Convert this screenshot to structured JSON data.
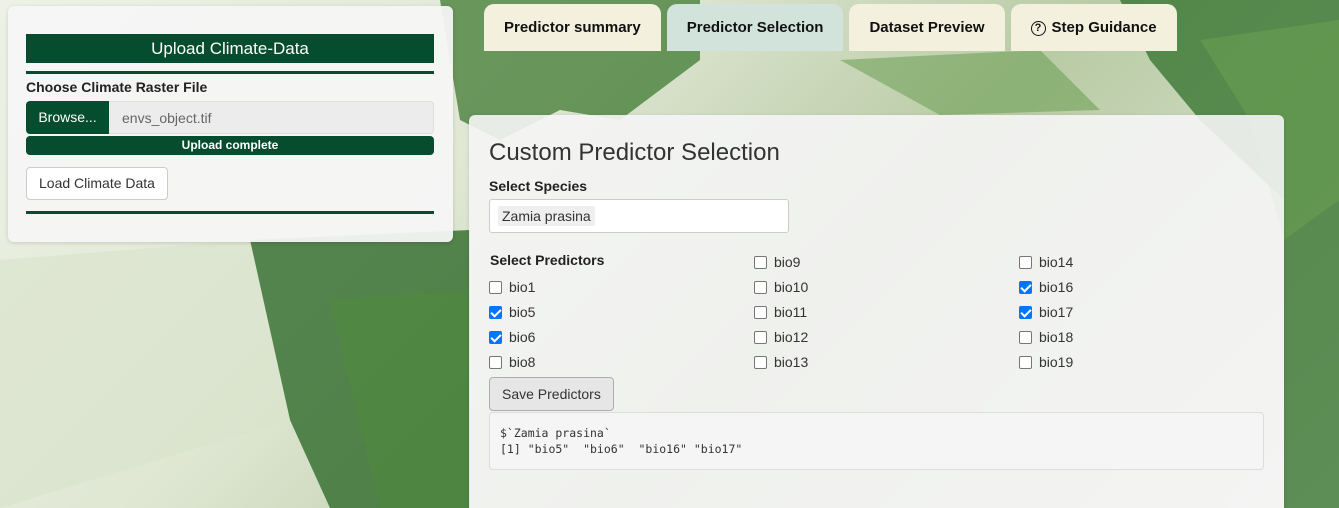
{
  "upload_panel": {
    "header": "Upload Climate-Data",
    "file_label": "Choose Climate Raster File",
    "browse_label": "Browse...",
    "file_name": "envs_object.tif",
    "progress_text": "Upload complete",
    "load_button": "Load Climate Data"
  },
  "tabs": [
    {
      "label": "Predictor summary",
      "active": false
    },
    {
      "label": "Predictor Selection",
      "active": true
    },
    {
      "label": "Dataset Preview",
      "active": false
    },
    {
      "label": "Step Guidance",
      "active": false,
      "icon": "question-circle-icon"
    }
  ],
  "selection": {
    "title": "Custom Predictor Selection",
    "species_label": "Select Species",
    "species_value": "Zamia prasina",
    "predictors_label": "Select Predictors",
    "predictors": [
      {
        "name": "bio1",
        "checked": false
      },
      {
        "name": "bio5",
        "checked": true
      },
      {
        "name": "bio6",
        "checked": true
      },
      {
        "name": "bio8",
        "checked": false
      },
      {
        "name": "bio9",
        "checked": false
      },
      {
        "name": "bio10",
        "checked": false
      },
      {
        "name": "bio11",
        "checked": false
      },
      {
        "name": "bio12",
        "checked": false
      },
      {
        "name": "bio13",
        "checked": false
      },
      {
        "name": "bio14",
        "checked": false
      },
      {
        "name": "bio16",
        "checked": true
      },
      {
        "name": "bio17",
        "checked": true
      },
      {
        "name": "bio18",
        "checked": false
      },
      {
        "name": "bio19",
        "checked": false
      }
    ],
    "save_button": "Save Predictors",
    "output_line1": "$`Zamia prasina`",
    "output_line2": "[1] \"bio5\"  \"bio6\"  \"bio16\" \"bio17\""
  },
  "colors": {
    "brand_green": "#064c2e",
    "checkbox_blue": "#0075ff",
    "active_tab": "#d2e3dc",
    "inactive_tab": "#f3f1de"
  }
}
